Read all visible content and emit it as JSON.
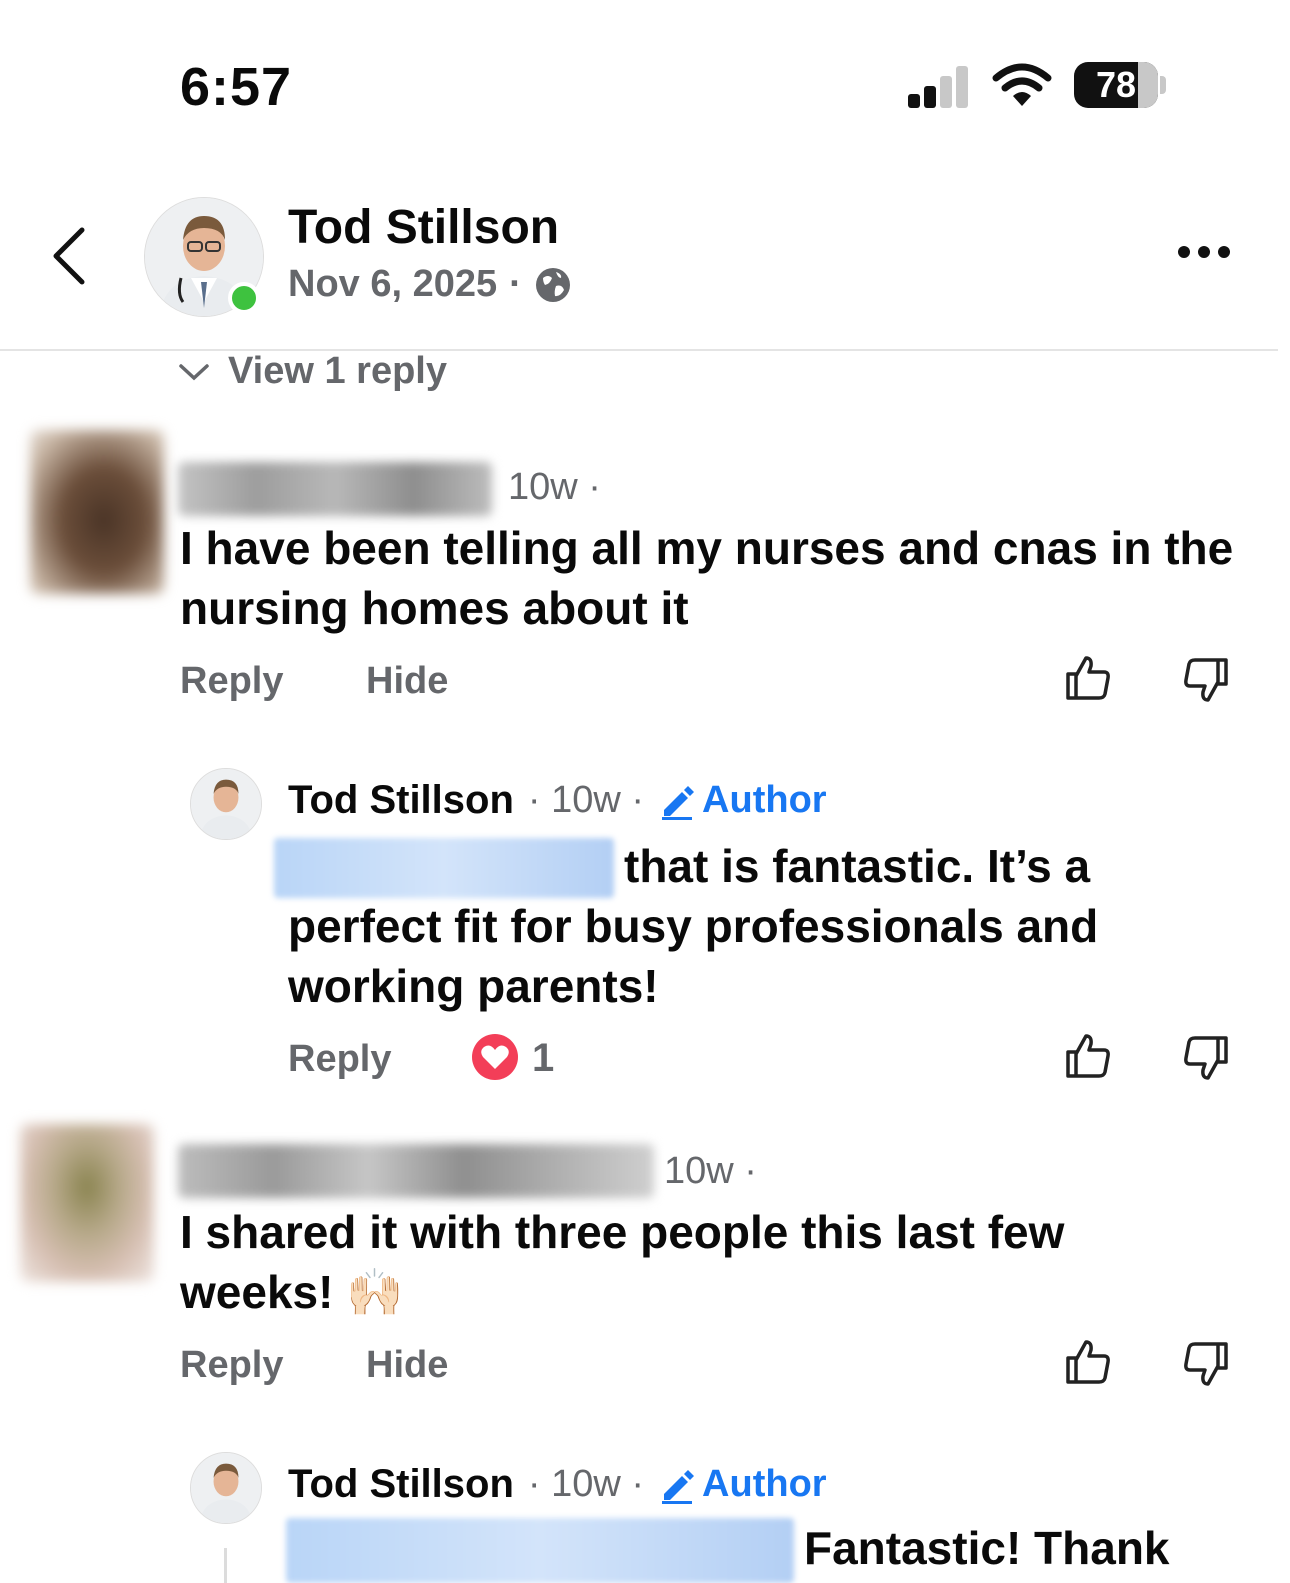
{
  "status_bar": {
    "time": "6:57",
    "battery": "78"
  },
  "header": {
    "name": "Tod Stillson",
    "date": "Nov 6, 2025",
    "separator": "·"
  },
  "view_replies": "View 1 reply",
  "comments": [
    {
      "time": "10w ·",
      "text": "I have been telling all my nurses and cnas in the nursing homes about it",
      "actions": {
        "reply": "Reply",
        "hide": "Hide"
      }
    },
    {
      "time": "10w ·",
      "text_line1": "I shared it with three people this last few",
      "text_line2": "weeks! 🙌🏻",
      "actions": {
        "reply": "Reply",
        "hide": "Hide"
      }
    }
  ],
  "replies": [
    {
      "name": "Tod Stillson",
      "meta": "· 10w ·",
      "author_label": "Author",
      "text_line1": "that is fantastic. It’s a",
      "text_line2": "perfect fit for busy professionals and",
      "text_line3": "working parents!",
      "reply_label": "Reply",
      "reaction_count": "1"
    },
    {
      "name": "Tod Stillson",
      "meta": "· 10w ·",
      "author_label": "Author",
      "text_line1": "Fantastic! Thank"
    }
  ],
  "colors": {
    "accent": "#1877f2",
    "secondary_text": "#65676b",
    "online": "#3ec23f",
    "heart": "#f33e58"
  },
  "icons": [
    "back-chevron-icon",
    "globe-icon",
    "more-icon",
    "chevron-down-icon",
    "thumbs-up-icon",
    "thumbs-down-icon",
    "pencil-icon",
    "heart-icon",
    "signal-icon",
    "wifi-icon",
    "battery-icon"
  ]
}
